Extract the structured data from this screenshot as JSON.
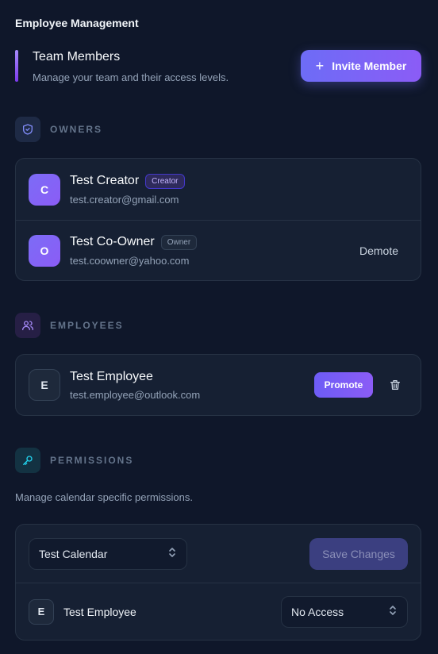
{
  "app_title": "Employee Management",
  "header": {
    "title": "Team Members",
    "subtitle": "Manage your team and their access levels.",
    "invite_label": "Invite Member"
  },
  "owners": {
    "label": "OWNERS",
    "members": [
      {
        "initial": "C",
        "name": "Test Creator",
        "badge": "Creator",
        "email": "test.creator@gmail.com"
      },
      {
        "initial": "O",
        "name": "Test Co-Owner",
        "badge": "Owner",
        "email": "test.coowner@yahoo.com",
        "action": "Demote"
      }
    ]
  },
  "employees": {
    "label": "EMPLOYEES",
    "members": [
      {
        "initial": "E",
        "name": "Test Employee",
        "email": "test.employee@outlook.com",
        "action": "Promote"
      }
    ]
  },
  "permissions": {
    "label": "PERMISSIONS",
    "description": "Manage calendar specific permissions.",
    "calendar_select": "Test Calendar",
    "save_label": "Save Changes",
    "rows": [
      {
        "initial": "E",
        "name": "Test Employee",
        "access": "No Access"
      }
    ]
  },
  "colors": {
    "accent": "#7c6cf6",
    "background": "#0f172a",
    "card": "#162033"
  }
}
